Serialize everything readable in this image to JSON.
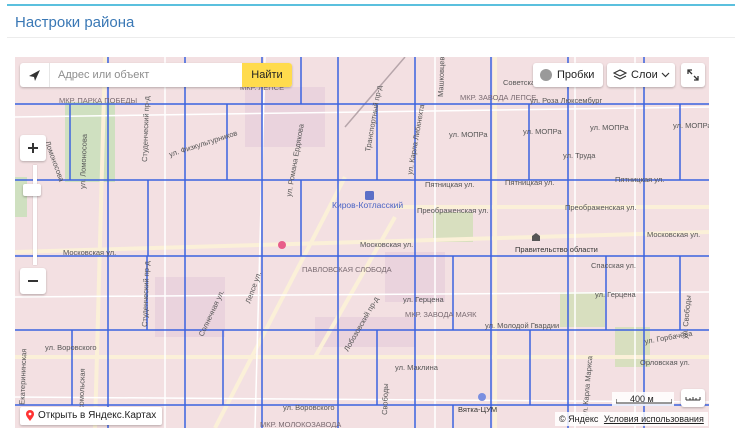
{
  "panel": {
    "title": "Настроки района"
  },
  "search": {
    "placeholder": "Адрес или объект",
    "button_label": "Найти"
  },
  "controls": {
    "traffic_label": "Пробки",
    "layers_label": "Слои"
  },
  "map": {
    "districts": [
      "МКР. ПАРКА ПОБЕДЫ",
      "МКР. ЛЕПСЕ",
      "МКР. ЗАВОДА ЛЕПСЕ",
      "ПАВЛОВСКАЯ СЛОБОДА",
      "МКР. ЗАВОДА МАЯК",
      "МКР. МОЛОКОЗАВОДА"
    ],
    "streets": [
      "Ломоносова",
      "ул. Физкультурников",
      "Студенческий пр-д",
      "ул. Ломоносова",
      "Московская ул.",
      "Московская ул.",
      "ул. Романа Ердякова",
      "Транспортный пр-д",
      "ул. МОПРа",
      "ул. МОПРа",
      "ул. МОПРа",
      "ул. МОПРа",
      "Пятницкая ул.",
      "Пятницкая ул.",
      "Пятницкая ул.",
      "ул. Труда",
      "Преображенская ул.",
      "Преображенская ул.",
      "Московская ул.",
      "Спасская ул.",
      "ул. Герцена",
      "ул. Герцена",
      "ул. Молодой Гвардии",
      "Лепсе ул.",
      "Солнечная ул.",
      "Лобозовский пр-д",
      "ул. Воровского",
      "ул. Воровского",
      "ул. Маклина",
      "ул. Горбачёва",
      "Орловская ул.",
      "ул. Свободы",
      "ул. Карла Маркса",
      "ул. Роза Люксембург",
      "Советская",
      "Машковцева",
      "ул. Карла Либкнехта",
      "Студенческий пр-д",
      "ул. Екатерининская",
      "Комсомольская",
      "Свободы"
    ],
    "pois": [
      {
        "name": "Киров-Котласский"
      },
      {
        "name": "Правительство области"
      },
      {
        "name": "Вятка-ЦУМ"
      }
    ],
    "bottom_link": "Открыть в Яндекс.Картах",
    "scale": "400 м",
    "copyright_brand": "© Яндекс",
    "copyright_terms": "Условия использования"
  },
  "colors": {
    "grid": "#3b62e0",
    "accent": "#ffdb4d",
    "title": "#3a78b5",
    "topline": "#5bc0de"
  }
}
